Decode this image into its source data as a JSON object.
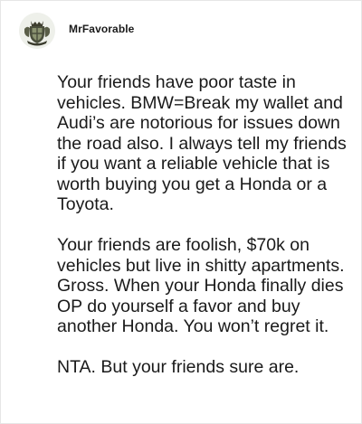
{
  "post": {
    "username": "MrFavorable",
    "avatar_icon": "crest-avatar-icon",
    "paragraphs": [
      "Your friends have poor taste in vehicles. BMW=Break my wallet and Audi’s are notorious for issues down the road also. I always tell my friends if you want a reliable vehicle that is worth buying you get a Honda or a Toyota.",
      "Your friends are foolish, $70k on vehicles but live in shitty apartments. Gross. When your Honda finally dies OP do yourself a favor and buy another Honda. You won’t regret it.",
      "NTA. But your friends sure are."
    ]
  },
  "colors": {
    "text": "#1a1a1a",
    "border": "#e6e6e6",
    "background": "#ffffff"
  }
}
